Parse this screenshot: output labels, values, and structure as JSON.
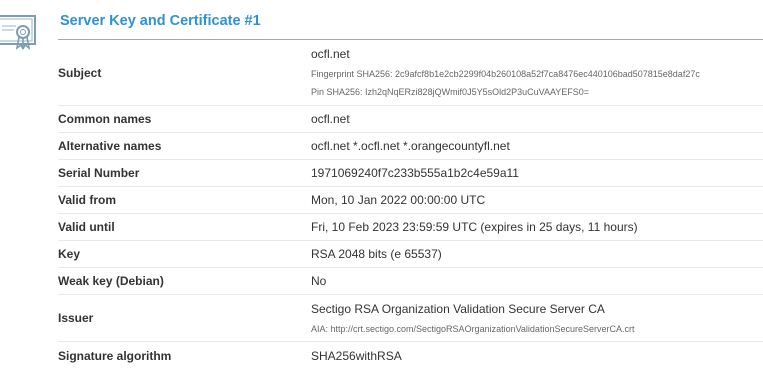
{
  "section": {
    "title": "Server Key and Certificate #1",
    "icon": "certificate-icon"
  },
  "rows": [
    {
      "label": "Subject",
      "value": "ocfl.net",
      "fingerprint": "Fingerprint SHA256: 2c9afcf8b1e2cb2299f04b260108a52f7ca8476ec440106bad507815e8daf27c",
      "pin": "Pin SHA256: Izh2qNqERzi828jQWmif0J5Y5sOld2P3uCuVAAYEFS0="
    },
    {
      "label": "Common names",
      "value": "ocfl.net"
    },
    {
      "label": "Alternative names",
      "value": "ocfl.net *.ocfl.net *.orangecountyfl.net"
    },
    {
      "label": "Serial Number",
      "value": "1971069240f7c233b555a1b2c4e59a11"
    },
    {
      "label": "Valid from",
      "value": "Mon, 10 Jan 2022 00:00:00 UTC"
    },
    {
      "label": "Valid until",
      "value": "Fri, 10 Feb 2023 23:59:59 UTC (expires in 25 days, 11 hours)"
    },
    {
      "label": "Key",
      "value": "RSA 2048 bits (e 65537)"
    },
    {
      "label": "Weak key (Debian)",
      "value": "No"
    },
    {
      "label": "Issuer",
      "value": "Sectigo RSA Organization Validation Secure Server CA",
      "aia": "AIA: http://crt.sectigo.com/SectigoRSAOrganizationValidationSecureServerCA.crt"
    },
    {
      "label": "Signature algorithm",
      "value": "SHA256withRSA"
    }
  ],
  "colors": {
    "title": "#2e92d6",
    "rule": "#a8a8a8",
    "row_border": "#e8e8e8",
    "icon": "#7d9db0"
  }
}
